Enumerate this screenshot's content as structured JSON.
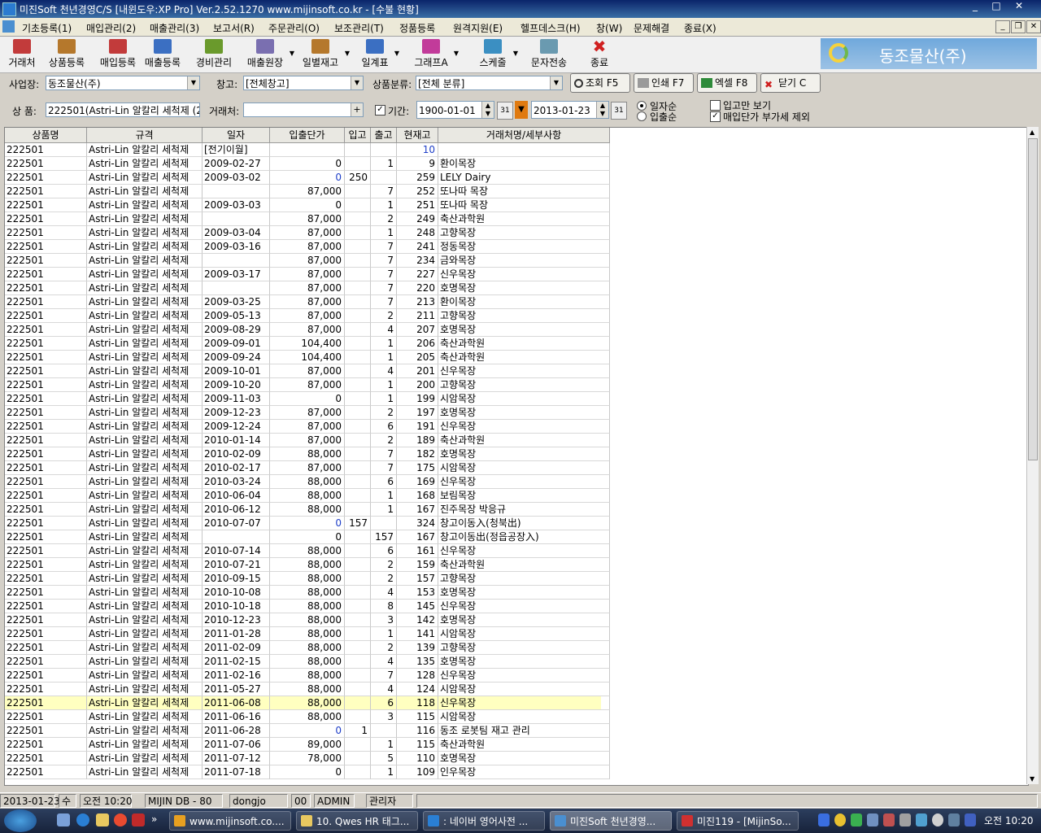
{
  "window": {
    "title": "미진Soft 천년경영C/S [내윈도우:XP Pro] Ver.2.52.1270          www.mijinsoft.co.kr - [수불 현황]",
    "controls": [
      "_",
      "□",
      "✕"
    ]
  },
  "menu": [
    "기초등록(1)",
    "매입관리(2)",
    "매출관리(3)",
    "보고서(R)",
    "주문관리(O)",
    "보조관리(T)",
    "정품등록",
    "원격지원(E)",
    "헬프데스크(H)",
    "창(W)",
    "문제해결",
    "종료(X)"
  ],
  "mdi_controls": [
    "_",
    "❐",
    "✕"
  ],
  "toolbar": [
    {
      "label": "거래처",
      "color": "#c23b3b"
    },
    {
      "label": "상품등록",
      "color": "#b5782c"
    },
    {
      "label": "매입등록",
      "color": "#c23b3b"
    },
    {
      "label": "매출등록",
      "color": "#3b6fc2"
    },
    {
      "label": "경비관리",
      "color": "#6a9a2c"
    },
    {
      "label": "매출원장",
      "color": "#7a6fb0"
    },
    {
      "label": "일별재고",
      "color": "#b5782c"
    },
    {
      "label": "일계표",
      "color": "#3b6fc2"
    },
    {
      "label": "그래프A",
      "color": "#c23b9a"
    },
    {
      "label": "스케줄",
      "color": "#3b8fc2"
    },
    {
      "label": "문자전송",
      "color": "#6a9ab0"
    },
    {
      "label": "종료",
      "color": "#d02020"
    }
  ],
  "company_name": "동조물산(주)",
  "filters": {
    "site_label": "사업장:",
    "site_value": "동조물산(주)",
    "warehouse_label": "창고:",
    "warehouse_value": "[전체창고]",
    "category_label": "상품분류:",
    "category_value": "[전체 분류]",
    "product_label": "상  품:",
    "product_value": "222501(Astri-Lin 알칼리 세척제 (25",
    "client_label": "거래처:",
    "client_value": "",
    "period_label": "기간:",
    "date_from": "1900-01-01",
    "date_to": "2013-01-23",
    "date_picker_glyph": "31",
    "sort_date": "일자순",
    "sort_io": "입출순",
    "only_in": "입고만 보기",
    "exclude_vat": "매입단가 부가세 제외",
    "period_checked": true,
    "only_in_checked": false,
    "exclude_vat_checked": true
  },
  "buttons": {
    "search": "조회 F5",
    "print": "인쇄 F7",
    "excel": "엑셀 F8",
    "close": "닫기 C"
  },
  "table": {
    "columns": [
      "상품명",
      "규격",
      "일자",
      "입출단가",
      "입고",
      "출고",
      "현재고",
      "거래처명/세부사항"
    ],
    "rows": [
      [
        "222501",
        "Astri-Lin 알칼리 세척제",
        "[전기이월]",
        "",
        "",
        "",
        "10",
        ""
      ],
      [
        "222501",
        "Astri-Lin 알칼리 세척제",
        "2009-02-27",
        "0",
        "",
        "1",
        "9",
        "환이목장"
      ],
      [
        "222501",
        "Astri-Lin 알칼리 세척제",
        "2009-03-02",
        "0",
        "250",
        "",
        "259",
        "LELY Dairy"
      ],
      [
        "222501",
        "Astri-Lin 알칼리 세척제",
        "",
        "87,000",
        "",
        "7",
        "252",
        "또나따 목장"
      ],
      [
        "222501",
        "Astri-Lin 알칼리 세척제",
        "2009-03-03",
        "0",
        "",
        "1",
        "251",
        "또나따 목장"
      ],
      [
        "222501",
        "Astri-Lin 알칼리 세척제",
        "",
        "87,000",
        "",
        "2",
        "249",
        "축산과학원"
      ],
      [
        "222501",
        "Astri-Lin 알칼리 세척제",
        "2009-03-04",
        "87,000",
        "",
        "1",
        "248",
        "고향목장"
      ],
      [
        "222501",
        "Astri-Lin 알칼리 세척제",
        "2009-03-16",
        "87,000",
        "",
        "7",
        "241",
        "정동목장"
      ],
      [
        "222501",
        "Astri-Lin 알칼리 세척제",
        "",
        "87,000",
        "",
        "7",
        "234",
        "금와목장"
      ],
      [
        "222501",
        "Astri-Lin 알칼리 세척제",
        "2009-03-17",
        "87,000",
        "",
        "7",
        "227",
        "신우목장"
      ],
      [
        "222501",
        "Astri-Lin 알칼리 세척제",
        "",
        "87,000",
        "",
        "7",
        "220",
        "호명목장"
      ],
      [
        "222501",
        "Astri-Lin 알칼리 세척제",
        "2009-03-25",
        "87,000",
        "",
        "7",
        "213",
        "환이목장"
      ],
      [
        "222501",
        "Astri-Lin 알칼리 세척제",
        "2009-05-13",
        "87,000",
        "",
        "2",
        "211",
        "고향목장"
      ],
      [
        "222501",
        "Astri-Lin 알칼리 세척제",
        "2009-08-29",
        "87,000",
        "",
        "4",
        "207",
        "호명목장"
      ],
      [
        "222501",
        "Astri-Lin 알칼리 세척제",
        "2009-09-01",
        "104,400",
        "",
        "1",
        "206",
        "축산과학원"
      ],
      [
        "222501",
        "Astri-Lin 알칼리 세척제",
        "2009-09-24",
        "104,400",
        "",
        "1",
        "205",
        "축산과학원"
      ],
      [
        "222501",
        "Astri-Lin 알칼리 세척제",
        "2009-10-01",
        "87,000",
        "",
        "4",
        "201",
        "신우목장"
      ],
      [
        "222501",
        "Astri-Lin 알칼리 세척제",
        "2009-10-20",
        "87,000",
        "",
        "1",
        "200",
        "고향목장"
      ],
      [
        "222501",
        "Astri-Lin 알칼리 세척제",
        "2009-11-03",
        "0",
        "",
        "1",
        "199",
        "시암목장"
      ],
      [
        "222501",
        "Astri-Lin 알칼리 세척제",
        "2009-12-23",
        "87,000",
        "",
        "2",
        "197",
        "호명목장"
      ],
      [
        "222501",
        "Astri-Lin 알칼리 세척제",
        "2009-12-24",
        "87,000",
        "",
        "6",
        "191",
        "신우목장"
      ],
      [
        "222501",
        "Astri-Lin 알칼리 세척제",
        "2010-01-14",
        "87,000",
        "",
        "2",
        "189",
        "축산과학원"
      ],
      [
        "222501",
        "Astri-Lin 알칼리 세척제",
        "2010-02-09",
        "88,000",
        "",
        "7",
        "182",
        "호명목장"
      ],
      [
        "222501",
        "Astri-Lin 알칼리 세척제",
        "2010-02-17",
        "87,000",
        "",
        "7",
        "175",
        "시암목장"
      ],
      [
        "222501",
        "Astri-Lin 알칼리 세척제",
        "2010-03-24",
        "88,000",
        "",
        "6",
        "169",
        "신우목장"
      ],
      [
        "222501",
        "Astri-Lin 알칼리 세척제",
        "2010-06-04",
        "88,000",
        "",
        "1",
        "168",
        "보림목장"
      ],
      [
        "222501",
        "Astri-Lin 알칼리 세척제",
        "2010-06-12",
        "88,000",
        "",
        "1",
        "167",
        "진주목장 박응규"
      ],
      [
        "222501",
        "Astri-Lin 알칼리 세척제",
        "2010-07-07",
        "0",
        "157",
        "",
        "324",
        "창고이동入(청북出)"
      ],
      [
        "222501",
        "Astri-Lin 알칼리 세척제",
        "",
        "0",
        "",
        "157",
        "167",
        "창고이동出(정읍공장入)"
      ],
      [
        "222501",
        "Astri-Lin 알칼리 세척제",
        "2010-07-14",
        "88,000",
        "",
        "6",
        "161",
        "신우목장"
      ],
      [
        "222501",
        "Astri-Lin 알칼리 세척제",
        "2010-07-21",
        "88,000",
        "",
        "2",
        "159",
        "축산과학원"
      ],
      [
        "222501",
        "Astri-Lin 알칼리 세척제",
        "2010-09-15",
        "88,000",
        "",
        "2",
        "157",
        "고향목장"
      ],
      [
        "222501",
        "Astri-Lin 알칼리 세척제",
        "2010-10-08",
        "88,000",
        "",
        "4",
        "153",
        "호명목장"
      ],
      [
        "222501",
        "Astri-Lin 알칼리 세척제",
        "2010-10-18",
        "88,000",
        "",
        "8",
        "145",
        "신우목장"
      ],
      [
        "222501",
        "Astri-Lin 알칼리 세척제",
        "2010-12-23",
        "88,000",
        "",
        "3",
        "142",
        "호명목장"
      ],
      [
        "222501",
        "Astri-Lin 알칼리 세척제",
        "2011-01-28",
        "88,000",
        "",
        "1",
        "141",
        "시암목장"
      ],
      [
        "222501",
        "Astri-Lin 알칼리 세척제",
        "2011-02-09",
        "88,000",
        "",
        "2",
        "139",
        "고향목장"
      ],
      [
        "222501",
        "Astri-Lin 알칼리 세척제",
        "2011-02-15",
        "88,000",
        "",
        "4",
        "135",
        "호명목장"
      ],
      [
        "222501",
        "Astri-Lin 알칼리 세척제",
        "2011-02-16",
        "88,000",
        "",
        "7",
        "128",
        "신우목장"
      ],
      [
        "222501",
        "Astri-Lin 알칼리 세척제",
        "2011-05-27",
        "88,000",
        "",
        "4",
        "124",
        "시암목장"
      ],
      [
        "222501",
        "Astri-Lin 알칼리 세척제",
        "2011-06-08",
        "88,000",
        "",
        "6",
        "118",
        "신우목장"
      ],
      [
        "222501",
        "Astri-Lin 알칼리 세척제",
        "2011-06-16",
        "88,000",
        "",
        "3",
        "115",
        "시암목장"
      ],
      [
        "222501",
        "Astri-Lin 알칼리 세척제",
        "2011-06-28",
        "0",
        "1",
        "",
        "116",
        "동조 로봇팀 재고 관리"
      ],
      [
        "222501",
        "Astri-Lin 알칼리 세척제",
        "2011-07-06",
        "89,000",
        "",
        "1",
        "115",
        "축산과학원"
      ],
      [
        "222501",
        "Astri-Lin 알칼리 세척제",
        "2011-07-12",
        "78,000",
        "",
        "5",
        "110",
        "호명목장"
      ],
      [
        "222501",
        "Astri-Lin 알칼리 세척제",
        "2011-07-18",
        "0",
        "",
        "1",
        "109",
        "인우목장"
      ]
    ],
    "selected_row": 40,
    "highlight_color": "#ffffc0",
    "blue_text_color": "#1f3fc8"
  },
  "status": [
    "2013-01-23",
    "수",
    "오전 10:20",
    "MIJIN DB - 80",
    "dongjo",
    "00",
    "ADMIN",
    "관리자"
  ],
  "taskbar": {
    "tasks": [
      {
        "label": "www.mijinsoft.co....",
        "color": "#e8a020"
      },
      {
        "label": "10. Qwes HR 태그...",
        "color": "#e8c860"
      },
      {
        "label": ": 네이버 영어사전 ...",
        "color": "#2a7fd4"
      },
      {
        "label": "미진Soft 천년경영...",
        "color": "#4a8fd0"
      },
      {
        "label": "미진119 - [MijinSo...",
        "color": "#d03030"
      }
    ],
    "clock": "오전 10:20"
  }
}
